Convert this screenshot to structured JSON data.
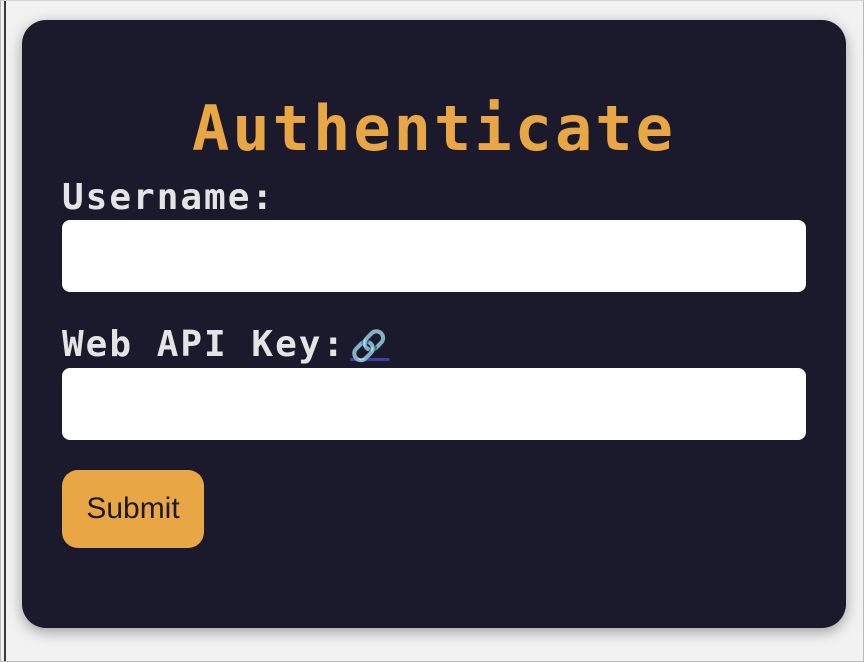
{
  "form": {
    "title": "Authenticate",
    "username_label": "Username:",
    "username_value": "",
    "api_key_label": "Web API Key:",
    "api_key_link_icon": "🔗",
    "api_key_value": "",
    "submit_label": "Submit"
  },
  "colors": {
    "card_background": "#1b1a2c",
    "accent": "#e9a644",
    "label_text": "#e4e4e4",
    "input_background": "#ffffff"
  },
  "icons": {
    "api_key_link": "link-icon"
  }
}
